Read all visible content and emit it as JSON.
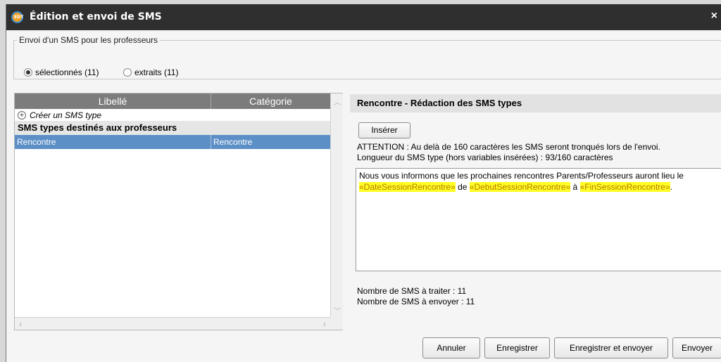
{
  "window": {
    "title": "Édition et envoi de SMS",
    "logo_text": "EDT",
    "close_glyph": "×"
  },
  "recipients": {
    "legend": "Envoi d'un SMS pour les professeurs",
    "options": [
      {
        "label": "sélectionnés (11)",
        "selected": true
      },
      {
        "label": "extraits (11)",
        "selected": false
      }
    ]
  },
  "list": {
    "columns": [
      "Libellé",
      "Catégorie"
    ],
    "create_label": "Créer un SMS type",
    "group_label": "SMS types destinés aux professeurs",
    "rows": [
      {
        "libelle": "Rencontre",
        "categorie": "Rencontre",
        "selected": true
      }
    ]
  },
  "editor": {
    "header": "Rencontre - Rédaction des SMS types",
    "insert_label": "Insérer",
    "warning": "ATTENTION : Au delà de 160 caractères les SMS seront tronqués lors de l'envoi.",
    "length_info": "Longueur du SMS type (hors variables insérées) : 93/160 caractères",
    "message": {
      "line1": "Nous vous informons que les prochaines rencontres Parents/Professeurs auront lieu le",
      "var1": "«DateSessionRencontre»",
      "sep1": " de ",
      "var2": "«DebutSessionRencontre»",
      "sep2": " à ",
      "var3": "«FinSessionRencontre»",
      "end": "."
    },
    "count_to_process": "Nombre de SMS à traiter : 11",
    "count_to_send": "Nombre de SMS à envoyer : 11"
  },
  "footer": {
    "cancel": "Annuler",
    "save": "Enregistrer",
    "save_send": "Enregistrer et envoyer",
    "send": "Envoyer"
  }
}
